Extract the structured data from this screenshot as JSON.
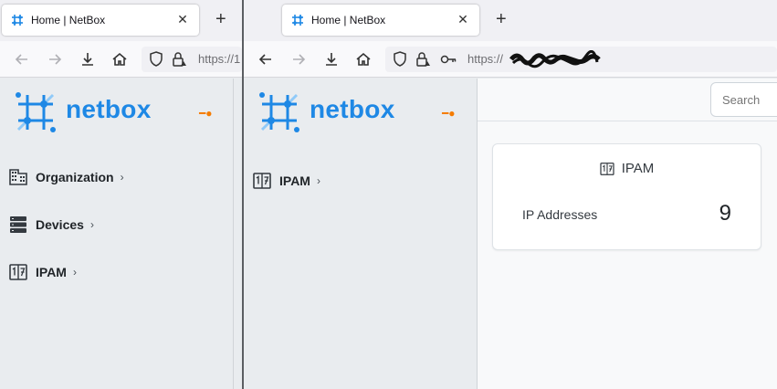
{
  "left_window": {
    "tab": {
      "title": "Home | NetBox",
      "close": "✕"
    },
    "new_tab": "+",
    "url": "https://1",
    "brand": {
      "name": "netbox"
    },
    "menu": [
      {
        "label": "Organization",
        "icon": "domain-icon"
      },
      {
        "label": "Devices",
        "icon": "server-icon"
      },
      {
        "label": "IPAM",
        "icon": "counter-icon"
      }
    ]
  },
  "right_window": {
    "tab": {
      "title": "Home | NetBox",
      "close": "✕"
    },
    "new_tab": "+",
    "url": "https://",
    "brand": {
      "name": "netbox"
    },
    "menu": [
      {
        "label": "IPAM",
        "icon": "counter-icon"
      }
    ],
    "search": {
      "placeholder": "Search"
    },
    "ipam_card": {
      "title": "IPAM",
      "rows": [
        {
          "label": "IP Addresses",
          "value": "9"
        }
      ]
    }
  },
  "colors": {
    "brand_blue": "#1e88e5",
    "pin_orange": "#f57c00"
  }
}
